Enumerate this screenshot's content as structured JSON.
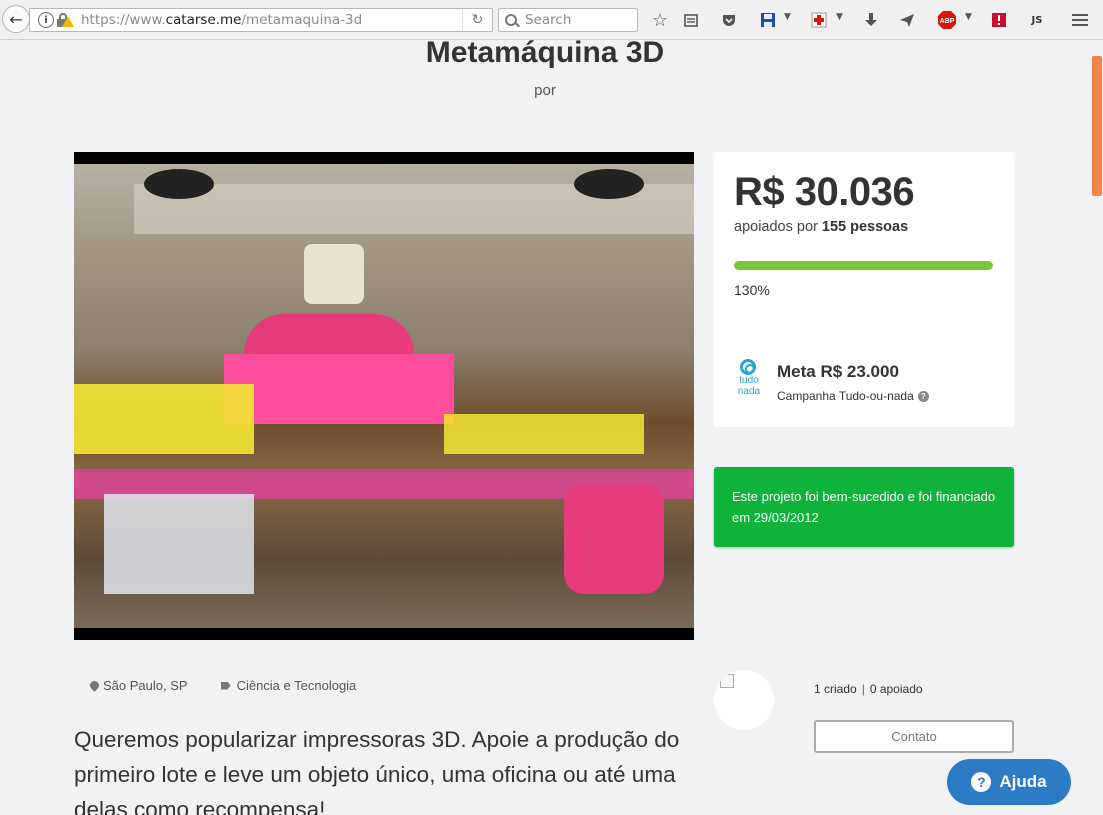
{
  "browser": {
    "url_prefix": "https://www.",
    "url_domain": "catarse.me",
    "url_path": "/metamaquina-3d",
    "search_placeholder": "Search",
    "abp_label": "ABP",
    "js_label": "JS"
  },
  "project": {
    "title": "Metamáquina 3D",
    "by": "por",
    "location": "São Paulo, SP",
    "category": "Ciência e Tecnologia",
    "headline": "Queremos popularizar impressoras 3D. Apoie a produção do primeiro lote e leve um objeto único, uma oficina ou até uma delas como recompensa!"
  },
  "stats": {
    "pledged": "R$ 30.036",
    "backers_prefix": "apoiados por",
    "backers_count": "155 pessoas",
    "progress_label": "130%",
    "progress_fraction": 1.0,
    "logo_text_line1": "tudo",
    "logo_text_line2": "nada",
    "goal": "Meta R$ 23.000",
    "campaign_type": "Campanha Tudo-ou-nada",
    "help_glyph": "?"
  },
  "success_message": "Este projeto foi bem-sucedido e foi financiado em 29/03/2012",
  "creator": {
    "created": "1 criado",
    "separator": "|",
    "backed": "0 apoiado",
    "contact_label": "Contato"
  },
  "help_widget": {
    "label": "Ajuda",
    "glyph": "?"
  },
  "colors": {
    "progress": "#7dc33f",
    "success": "#0fb23a",
    "help": "#2d7bc4",
    "scroll_thumb": "#f0844a"
  }
}
